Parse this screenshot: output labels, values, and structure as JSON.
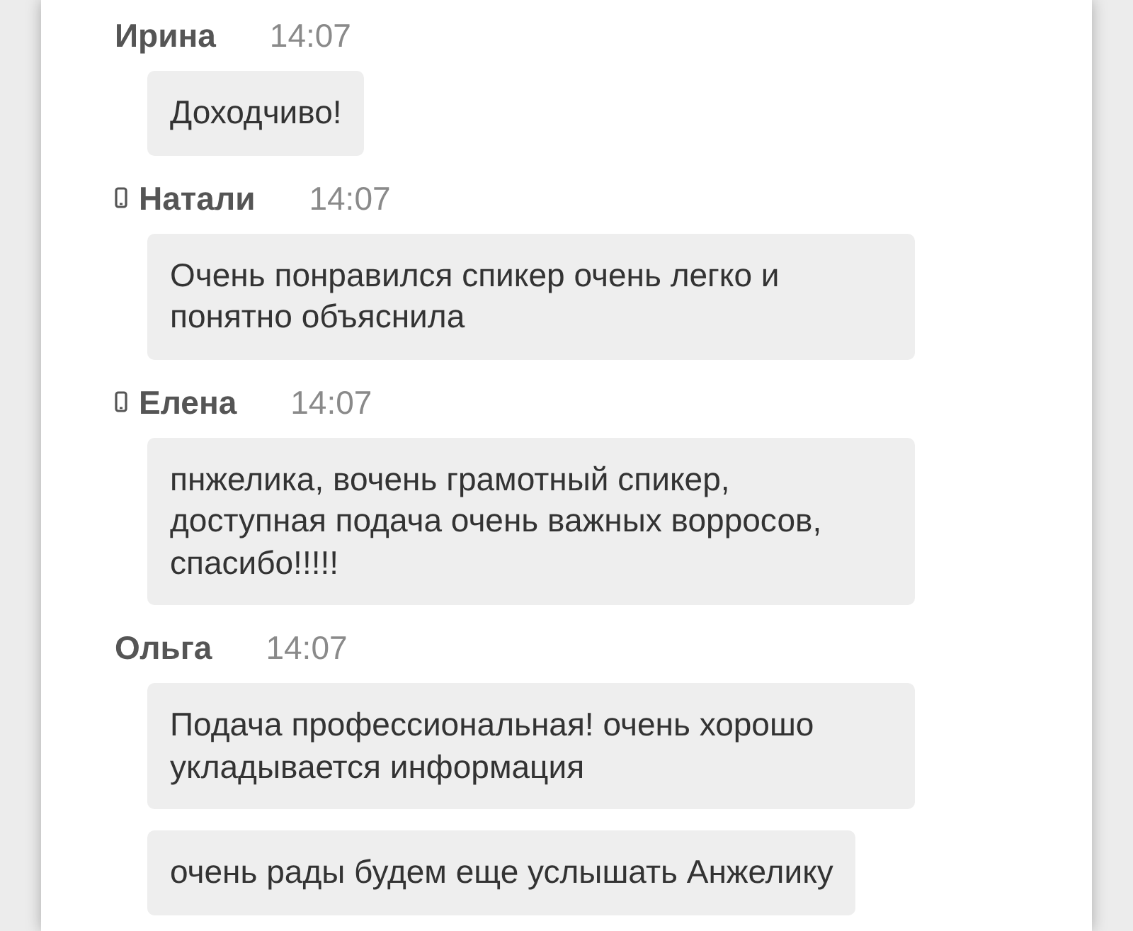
{
  "messages": [
    {
      "author": "Ирина",
      "time": "14:07",
      "mobile": false,
      "texts": [
        "Доходчиво!"
      ]
    },
    {
      "author": "Натали",
      "time": "14:07",
      "mobile": true,
      "texts": [
        "Очень понравился спикер очень легко и понятно объяснила"
      ]
    },
    {
      "author": "Елена",
      "time": "14:07",
      "mobile": true,
      "texts": [
        "пнжелика, вочень грамотный спикер, доступная подача очень важных ворросов, спасибо!!!!!"
      ]
    },
    {
      "author": "Ольга",
      "time": "14:07",
      "mobile": false,
      "texts": [
        "Подача профессиональная! очень хорошо укладывается информация",
        "очень рады будем еще услышать Анжелику"
      ]
    }
  ]
}
